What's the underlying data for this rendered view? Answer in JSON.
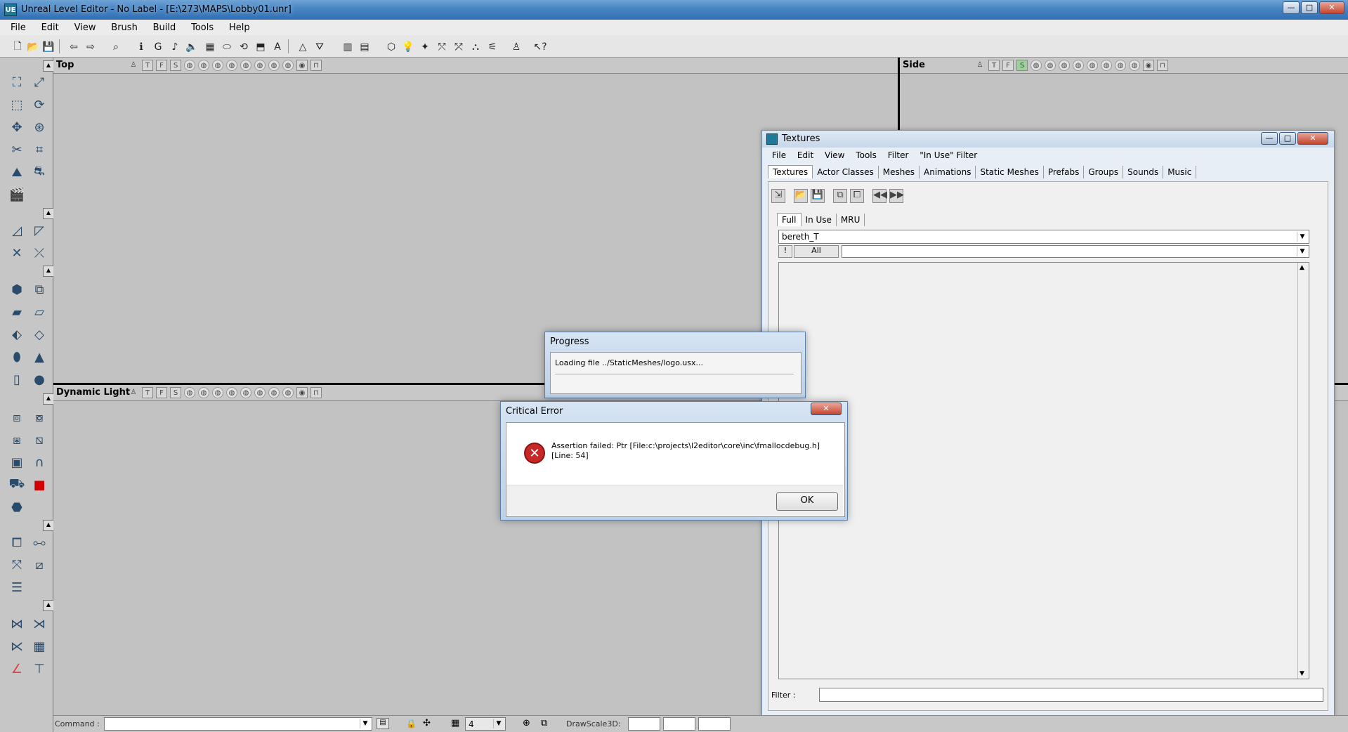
{
  "window": {
    "title": "Unreal Level Editor - No Label - [E:\\273\\MAPS\\Lobby01.unr]",
    "app_icon": "UE",
    "minimize_glyph": "—",
    "maximize_glyph": "□",
    "close_glyph": "✕"
  },
  "menu": [
    "File",
    "Edit",
    "View",
    "Brush",
    "Build",
    "Tools",
    "Help"
  ],
  "viewports": {
    "top": {
      "title": "Top"
    },
    "side": {
      "title": "Side"
    },
    "dynamic": {
      "title": "Dynamic Light"
    }
  },
  "viewport_icons": [
    "T",
    "F",
    "S"
  ],
  "textures_window": {
    "title": "Textures",
    "menu": [
      "File",
      "Edit",
      "View",
      "Tools",
      "Filter",
      "\"In Use\" Filter"
    ],
    "tabs": [
      "Textures",
      "Actor Classes",
      "Meshes",
      "Animations",
      "Static Meshes",
      "Prefabs",
      "Groups",
      "Sounds",
      "Music"
    ],
    "subtabs": [
      "Full",
      "In Use",
      "MRU"
    ],
    "package_value": "bereth_T",
    "group_button_exclaim": "!",
    "group_button_all": "All",
    "group_value": "",
    "filter_label": "Filter :",
    "filter_value": ""
  },
  "progress_dialog": {
    "title": "Progress",
    "message": "Loading file ../StaticMeshes/logo.usx..."
  },
  "error_dialog": {
    "title": "Critical Error",
    "message_line1": "Assertion failed: Ptr [File:c:\\projects\\l2editor\\core\\inc\\fmallocdebug.h]",
    "message_line2": "[Line: 54]",
    "ok_label": "OK",
    "close_glyph": "✕"
  },
  "statusbar": {
    "command_label": "Command :",
    "command_value": "",
    "grid_value": "4",
    "drawscale_label": "DrawScale3D:"
  },
  "colors": {
    "viewport_bg": "#c2c2c2",
    "title_bar": "#4a86c4",
    "error_icon": "#c62828"
  }
}
